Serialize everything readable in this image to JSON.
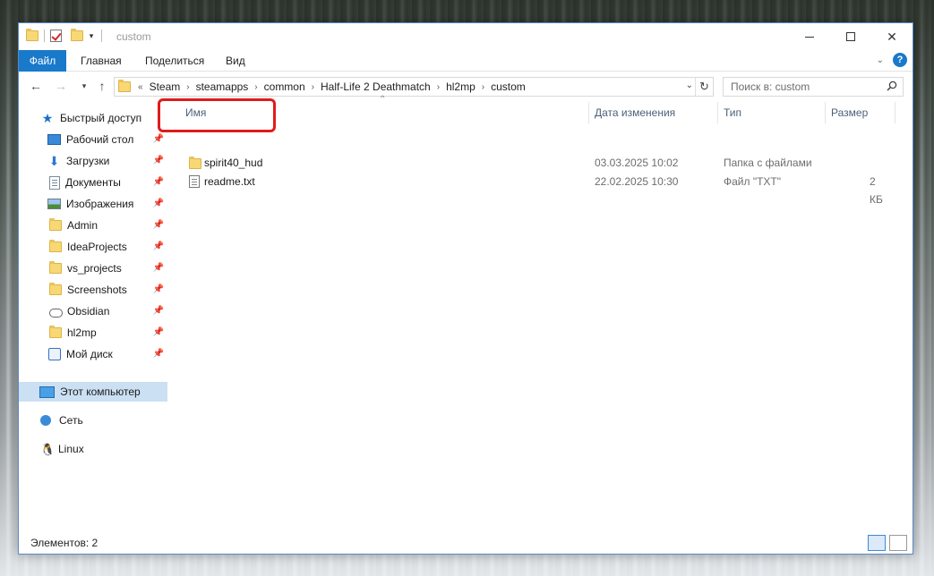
{
  "window": {
    "title": "custom"
  },
  "ribbon": {
    "tabs": [
      {
        "label": "Файл"
      },
      {
        "label": "Главная"
      },
      {
        "label": "Поделиться"
      },
      {
        "label": "Вид"
      }
    ]
  },
  "address": {
    "prefix": "«",
    "crumbs": [
      "Steam",
      "steamapps",
      "common",
      "Half-Life 2 Deathmatch",
      "hl2mp",
      "custom"
    ]
  },
  "search": {
    "placeholder": "Поиск в: custom"
  },
  "sidebar": {
    "quick_access": "Быстрый доступ",
    "items": [
      {
        "label": "Рабочий стол",
        "icon": "desktop-icon"
      },
      {
        "label": "Загрузки",
        "icon": "download-icon"
      },
      {
        "label": "Документы",
        "icon": "documents-icon"
      },
      {
        "label": "Изображения",
        "icon": "pictures-icon"
      },
      {
        "label": "Admin",
        "icon": "folder-icon"
      },
      {
        "label": "IdeaProjects",
        "icon": "folder-icon"
      },
      {
        "label": "vs_projects",
        "icon": "folder-icon"
      },
      {
        "label": "Screenshots",
        "icon": "folder-icon"
      },
      {
        "label": "Obsidian",
        "icon": "cloud-icon"
      },
      {
        "label": "hl2mp",
        "icon": "folder-icon"
      },
      {
        "label": "Мой диск",
        "icon": "drive-icon"
      }
    ],
    "this_pc": "Этот компьютер",
    "network": "Сеть",
    "linux": "Linux"
  },
  "columns": {
    "name": "Имя",
    "date": "Дата изменения",
    "type": "Тип",
    "size": "Размер"
  },
  "files": [
    {
      "name": "spirit40_hud",
      "date": "03.03.2025 10:02",
      "type": "Папка с файлами",
      "size": ""
    },
    {
      "name": "readme.txt",
      "date": "22.02.2025 10:30",
      "type": "Файл \"TXT\"",
      "size": "2 КБ"
    }
  ],
  "status": {
    "items": "Элементов: 2"
  },
  "colors": {
    "accent": "#1979ca",
    "highlight": "#e01b1b",
    "selected": "#cce0f4"
  }
}
